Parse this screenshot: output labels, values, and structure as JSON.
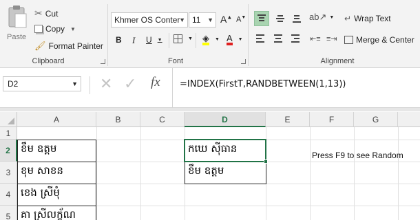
{
  "ribbon": {
    "clipboard": {
      "paste": "Paste",
      "cut": "Cut",
      "copy": "Copy",
      "format_painter": "Format Painter",
      "group_label": "Clipboard"
    },
    "font": {
      "font_name": "Khmer OS Conter",
      "font_size": "11",
      "bold": "B",
      "italic": "I",
      "underline": "U",
      "group_label": "Font",
      "font_color": "#e02020",
      "fill_color": "#ffff00"
    },
    "alignment": {
      "wrap_text": "Wrap Text",
      "merge_center": "Merge & Center",
      "group_label": "Alignment"
    }
  },
  "formula_bar": {
    "name_box": "D2",
    "fx": "fx",
    "formula": "=INDEX(FirstT,RANDBETWEEN(1,13))"
  },
  "sheet": {
    "columns": [
      "A",
      "B",
      "C",
      "D",
      "E",
      "F",
      "G"
    ],
    "rows": [
      "1",
      "2",
      "3",
      "4",
      "5"
    ],
    "selected_column": "D",
    "selected_row": "2",
    "column_a": [
      "ខឹម ឧត្តម",
      "ខុម សាខន",
      "ខេង ស្រីមុំ",
      "គា ស្រីលក្ខ័ណ"
    ],
    "column_d": [
      "កឃេ ស៊ីធាន",
      "ខឹម ឧត្តម"
    ],
    "hint": "Press F9 to see Random"
  },
  "colors": {
    "accent": "#217346"
  }
}
